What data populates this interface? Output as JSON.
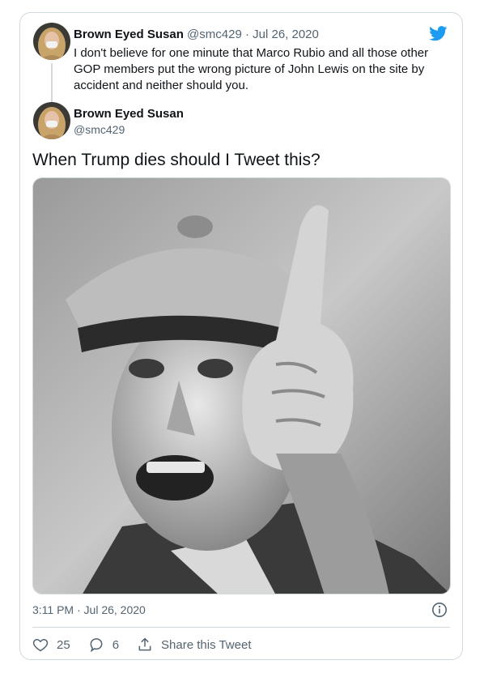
{
  "quoted_tweet": {
    "author_name": "Brown Eyed Susan",
    "author_handle": "@smc429",
    "separator": "·",
    "date": "Jul 26, 2020",
    "text": "I don't believe for one minute that Marco Rubio and all those other GOP members put the wrong picture of John Lewis on the site by accident and neither should you."
  },
  "tweet": {
    "author_name": "Brown Eyed Susan",
    "author_handle": "@smc429",
    "text": "When Trump dies should I Tweet this?",
    "media_description_icon": "photo",
    "timestamp": "3:11 PM · Jul 26, 2020",
    "likes": "25",
    "replies": "6",
    "share_label": "Share this Tweet"
  },
  "icons": {
    "brand": "twitter-bird-icon",
    "info": "info-icon",
    "like": "heart-icon",
    "reply": "reply-icon",
    "share": "share-icon"
  },
  "colors": {
    "brand_blue": "#1d9bf0",
    "muted_text": "#536471",
    "border": "#cfd9de"
  }
}
